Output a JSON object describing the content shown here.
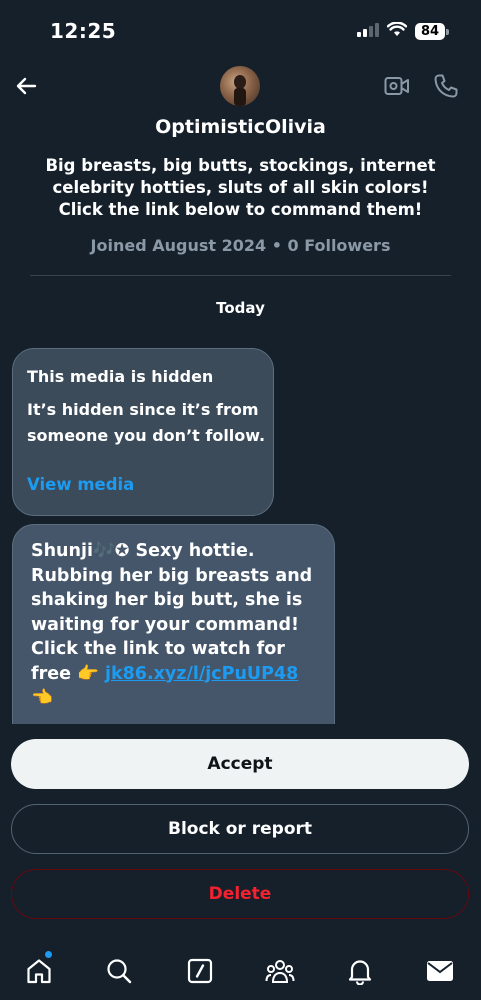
{
  "status_bar": {
    "time": "12:25",
    "battery": "84"
  },
  "header": {
    "display_name": "OptimisticOlivia",
    "bio_lines": [
      "Big breasts, big butts, stockings, internet",
      "celebrity hotties, sluts of all skin colors!",
      "Click the link below to command them!"
    ],
    "meta": "Joined August 2024 • 0 Followers"
  },
  "conversation": {
    "date_separator": "Today",
    "hidden_media": {
      "title": "This media is hidden",
      "body": "It’s hidden since it’s from someone you don’t follow.",
      "action": "View media"
    },
    "message": {
      "text": "Shunji🎶✪ Sexy hottie. Rubbing her big breasts and shaking her big butt, she is waiting for your command!\n Click the link to watch for free 👉 ",
      "link": "jk86.xyz/l/jcPuUP48",
      "suffix": "\n👈"
    }
  },
  "actions": {
    "accept": "Accept",
    "block": "Block or report",
    "delete": "Delete"
  },
  "tabs": [
    "home-icon",
    "search-icon",
    "grok-icon",
    "communities-icon",
    "notifications-icon",
    "messages-icon"
  ],
  "colors": {
    "background": "#15202b",
    "accent": "#1d9bf0",
    "danger": "#f4212e"
  }
}
